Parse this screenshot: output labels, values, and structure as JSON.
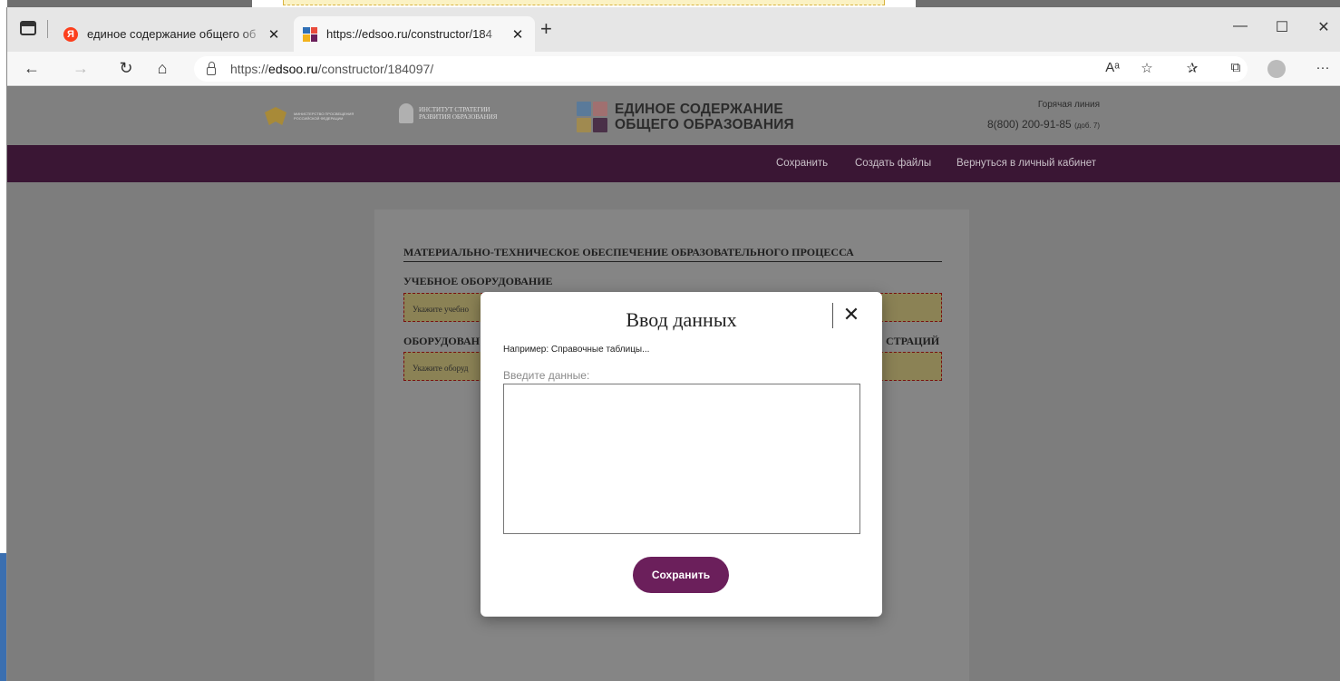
{
  "browser": {
    "tabs": [
      {
        "title": "единое содержание общего об",
        "active": false
      },
      {
        "title": "https://edsoo.ru/constructor/184",
        "active": true
      }
    ],
    "address": {
      "prefix": "https://",
      "host": "edsoo.ru",
      "path": "/constructor/184097/"
    },
    "icons": [
      "tab-actions-icon",
      "yandex-favicon",
      "edsoo-favicon",
      "close-icon",
      "plus-icon",
      "minimize-icon",
      "maximize-icon",
      "close-window-icon",
      "back-icon",
      "forward-icon",
      "refresh-icon",
      "home-icon",
      "lock-icon",
      "read-aloud-icon",
      "add-favorite-icon",
      "favorites-icon",
      "collections-icon",
      "profile-icon",
      "more-icon"
    ]
  },
  "site": {
    "logo_minpros": "МИНИСТЕРСТВО ПРОСВЕЩЕНИЯ РОССИЙСКОЙ ФЕДЕРАЦИИ",
    "logo_institute_line1": "ИНСТИТУТ СТРАТЕГИИ",
    "logo_institute_line2": "РАЗВИТИЯ ОБРАЗОВАНИЯ",
    "logo_title_line1": "ЕДИНОЕ СОДЕРЖАНИЕ",
    "logo_title_line2": "ОБЩЕГО ОБРАЗОВАНИЯ",
    "hotline_label": "Горячая линия",
    "hotline_phone": "8(800) 200-91-85",
    "hotline_ext": "(доб. 7)",
    "nav": [
      "Сохранить",
      "Создать файлы",
      "Вернуться в личный кабинет"
    ],
    "colors": {
      "nav_bg": "#6b1f5b",
      "field_bg": "#f4e487",
      "field_border": "#b01818"
    }
  },
  "document": {
    "heading": "МАТЕРИАЛЬНО-ТЕХНИЧЕСКОЕ ОБЕСПЕЧЕНИЕ ОБРАЗОВАТЕЛЬНОГО ПРОЦЕССА",
    "section1_title": "УЧЕБНОЕ ОБОРУДОВАНИЕ",
    "section1_field": "Укажите учебно",
    "section2_title_left": "ОБОРУДОВАН",
    "section2_title_right": "СТРАЦИЙ",
    "section2_field": "Укажите оборуд"
  },
  "modal": {
    "title": "Ввод данных",
    "close": "✕",
    "hint": "Например: Справочные таблицы...",
    "label": "Введите данные:",
    "value": "",
    "save_label": "Сохранить"
  }
}
